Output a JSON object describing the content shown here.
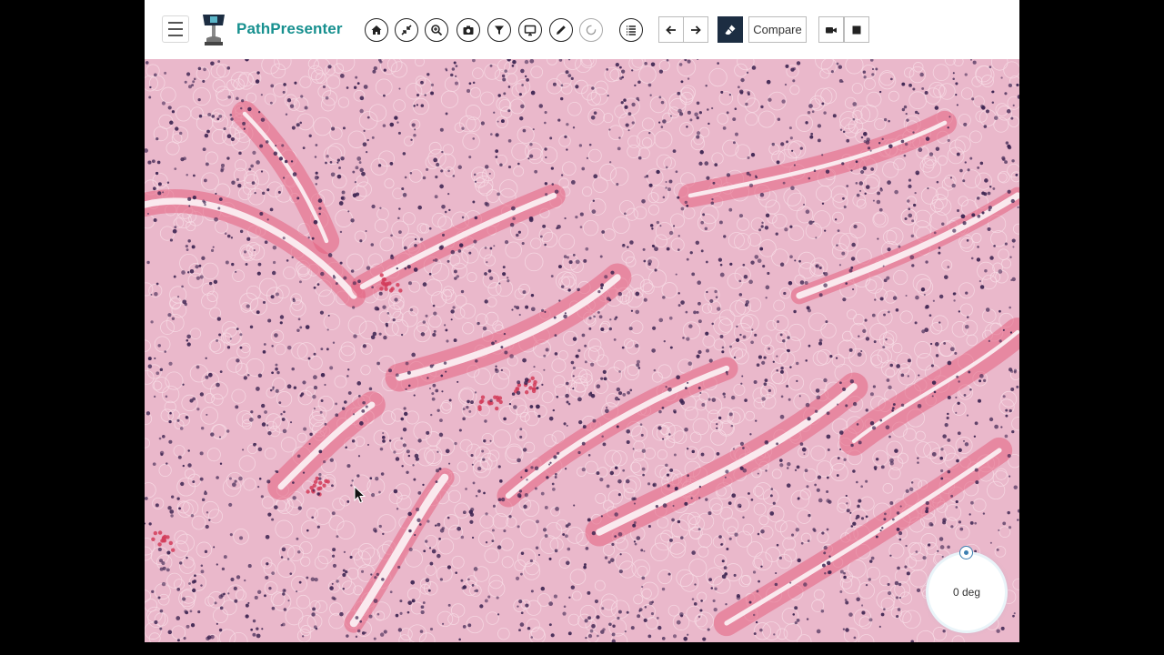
{
  "app": {
    "name": "PathPresenter"
  },
  "toolbar": {
    "compare_label": "Compare",
    "round_buttons": [
      {
        "name": "home",
        "icon": "home-icon"
      },
      {
        "name": "fit",
        "icon": "compress-icon"
      },
      {
        "name": "zoom",
        "icon": "zoom-icon"
      },
      {
        "name": "snapshot",
        "icon": "camera-icon"
      },
      {
        "name": "filter",
        "icon": "filter-icon"
      },
      {
        "name": "presentation",
        "icon": "monitor-icon"
      },
      {
        "name": "annotate",
        "icon": "pencil-icon"
      },
      {
        "name": "rotate",
        "icon": "rotate-icon"
      },
      {
        "name": "list",
        "icon": "list-icon"
      }
    ],
    "square_buttons": [
      {
        "name": "back",
        "icon": "arrow-left-icon"
      },
      {
        "name": "forward",
        "icon": "arrow-right-icon"
      },
      {
        "name": "annotation-tool",
        "icon": "eraser-icon",
        "active": true
      },
      {
        "name": "record",
        "icon": "video-camera-icon"
      },
      {
        "name": "stop",
        "icon": "stop-icon"
      }
    ]
  },
  "viewer": {
    "rotation_label": "0 deg",
    "stain_colors": {
      "background": "#eab8cb",
      "stroma": "#e3607f",
      "nuclei": "#3b2350",
      "lumen": "#fbeef2"
    }
  }
}
